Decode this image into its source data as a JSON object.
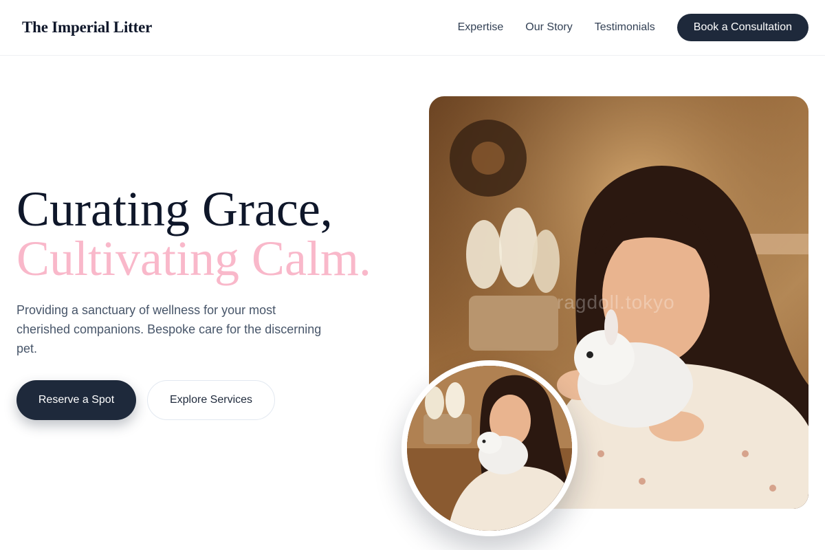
{
  "header": {
    "brand": "The Imperial Litter",
    "nav": [
      {
        "label": "Expertise"
      },
      {
        "label": "Our Story"
      },
      {
        "label": "Testimonials"
      }
    ],
    "cta_label": "Book a Consultation"
  },
  "hero": {
    "title_line1": "Curating Grace,",
    "title_line2": "Cultivating Calm.",
    "subtitle": "Providing a sanctuary of wellness for your most cherished companions. Bespoke care for the discerning pet.",
    "primary_button": "Reserve a Spot",
    "secondary_button": "Explore Services"
  },
  "images": {
    "main_photo": "woman holding white rabbit",
    "watermark": "ragdoll.tokyo",
    "inset_photo": "woman holding white rabbit"
  },
  "colors": {
    "navy": "#1e293b",
    "accent_pink": "#f9b8ca",
    "text_muted": "#475569"
  }
}
